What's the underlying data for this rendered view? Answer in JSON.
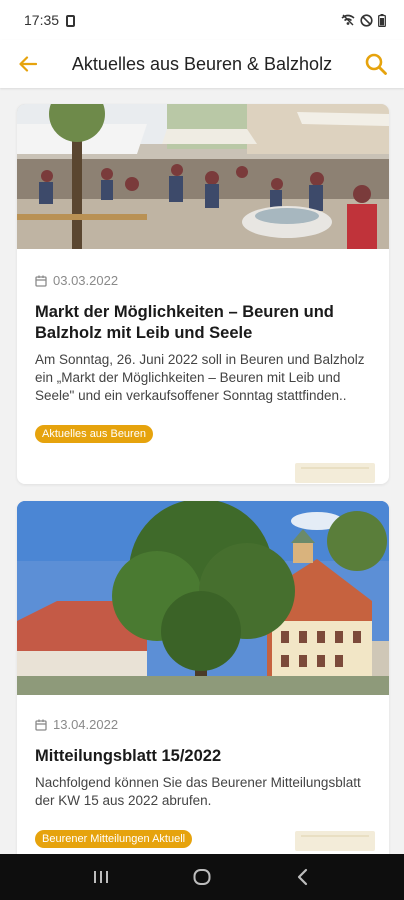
{
  "status_bar": {
    "time": "17:35",
    "icons": [
      "sim-card-icon",
      "wifi-off-icon",
      "do-not-disturb-icon",
      "battery-icon"
    ]
  },
  "app_bar": {
    "back_icon": "arrow-left-icon",
    "title": "Aktuelles aus Beuren & Balzholz",
    "search_icon": "search-icon",
    "accent_color": "#e6a30d"
  },
  "articles": [
    {
      "image_alt": "Marktplatz mit Menschen und Ständen",
      "date": "03.03.2022",
      "title": "Markt der Möglichkeiten – Beuren und Balzholz mit Leib und Seele",
      "excerpt": "Am Sonntag, 26. Juni 2022 soll in Beuren und Balzholz ein „Markt der Möglichkeiten – Beuren mit Leib und Seele\" und ein verkaufsoffener Sonntag stattfinden..",
      "tag": "Aktuelles aus Beuren"
    },
    {
      "image_alt": "Fachwerkrathaus mit großem Baum",
      "date": "13.04.2022",
      "title": "Mitteilungsblatt 15/2022",
      "excerpt": "Nachfolgend können Sie das Beurener Mitteilungsblatt der KW 15 aus 2022 abrufen.",
      "tag": "Beurener Mitteilungen Aktuell"
    }
  ],
  "nav_bar": {
    "icons": [
      "recent-apps-icon",
      "home-icon",
      "back-icon"
    ]
  }
}
